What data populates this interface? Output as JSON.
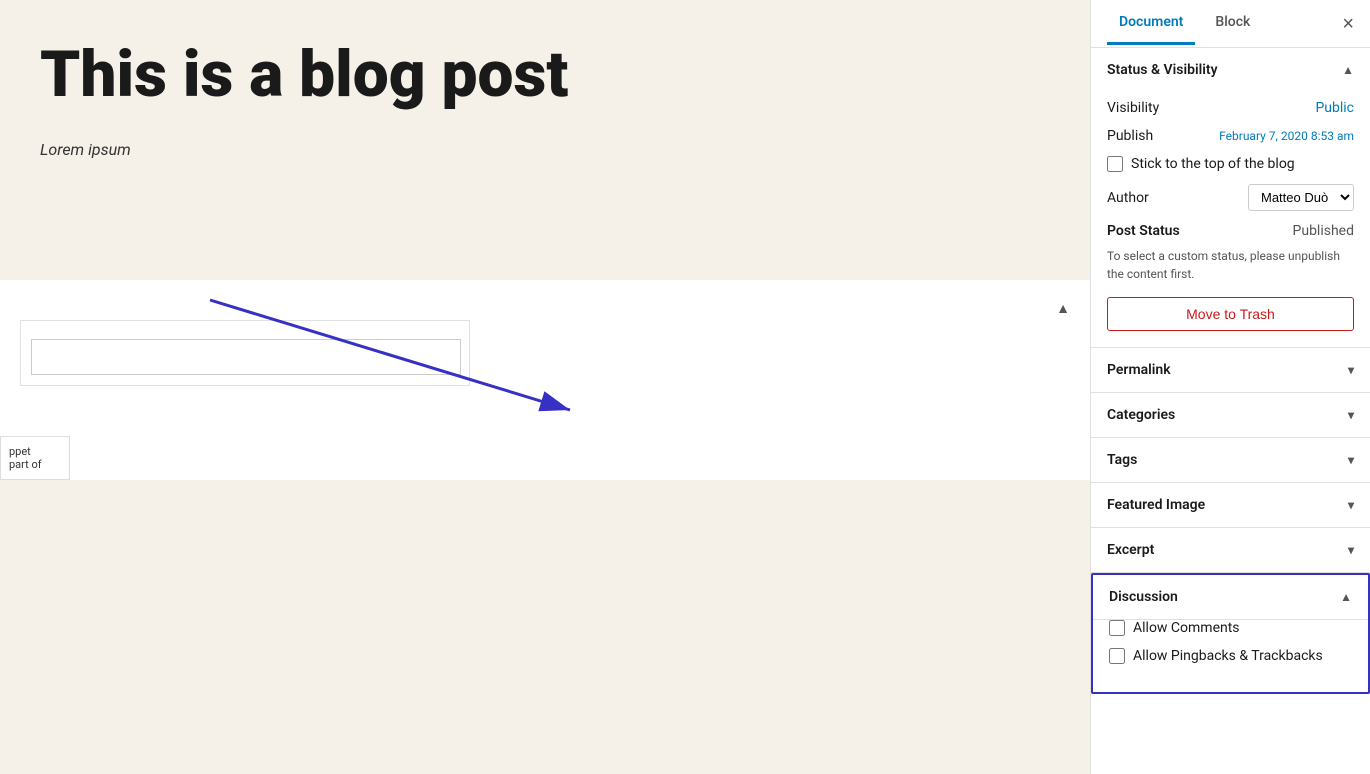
{
  "sidebar": {
    "tabs": [
      {
        "label": "Document",
        "active": true
      },
      {
        "label": "Block",
        "active": false
      }
    ],
    "close_label": "×",
    "sections": {
      "status_visibility": {
        "title": "Status & Visibility",
        "expanded": true,
        "visibility_label": "Visibility",
        "visibility_value": "Public",
        "publish_label": "Publish",
        "publish_value": "February 7, 2020 8:53 am",
        "stick_to_top_label": "Stick to the top of the blog",
        "stick_to_top_checked": false,
        "author_label": "Author",
        "author_value": "Matteo Duò",
        "post_status_label": "Post Status",
        "post_status_value": "Published",
        "custom_status_hint": "To select a custom status, please unpublish the content first.",
        "move_to_trash_label": "Move to Trash"
      },
      "permalink": {
        "title": "Permalink",
        "expanded": false
      },
      "categories": {
        "title": "Categories",
        "expanded": false
      },
      "tags": {
        "title": "Tags",
        "expanded": false
      },
      "featured_image": {
        "title": "Featured Image",
        "expanded": false
      },
      "excerpt": {
        "title": "Excerpt",
        "expanded": false
      },
      "discussion": {
        "title": "Discussion",
        "expanded": true,
        "allow_comments_label": "Allow Comments",
        "allow_comments_checked": false,
        "allow_pingbacks_label": "Allow Pingbacks & Trackbacks",
        "allow_pingbacks_checked": false
      }
    }
  },
  "main": {
    "blog_title": "This is a blog post",
    "lorem_text": "Lorem ipsum"
  }
}
